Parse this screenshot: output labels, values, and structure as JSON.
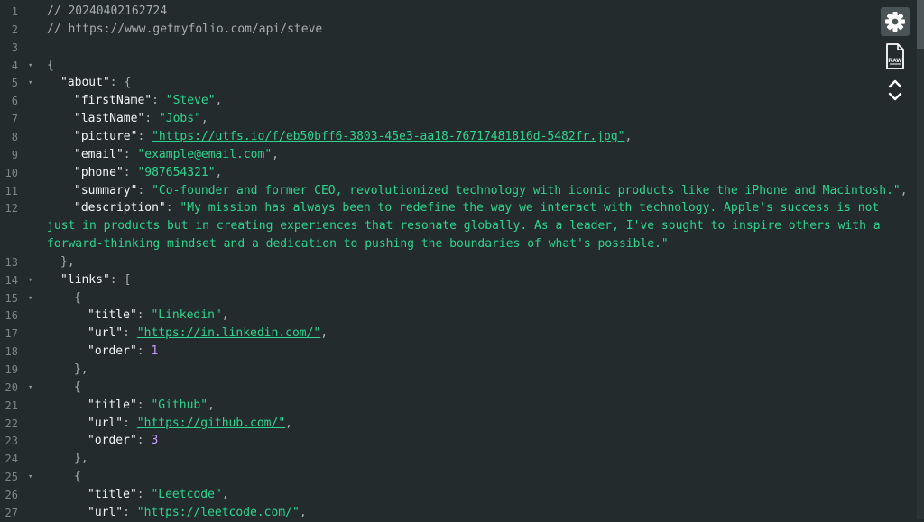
{
  "toolbar": {
    "settings_icon": "gear-icon",
    "raw_icon": "raw-file-icon",
    "raw_label": "RAW",
    "collapse_icon": "expand-collapse-chevrons-icon"
  },
  "lines": [
    {
      "n": "1",
      "fold": false,
      "indent": 0,
      "tokens": [
        {
          "t": "cmt",
          "v": "// 20240402162724"
        }
      ]
    },
    {
      "n": "2",
      "fold": false,
      "indent": 0,
      "tokens": [
        {
          "t": "cmt",
          "v": "// https://www.getmyfolio.com/api/steve"
        }
      ]
    },
    {
      "n": "3",
      "fold": false,
      "indent": 0,
      "tokens": []
    },
    {
      "n": "4",
      "fold": true,
      "indent": 0,
      "tokens": [
        {
          "t": "punc",
          "v": "{"
        }
      ]
    },
    {
      "n": "5",
      "fold": true,
      "indent": 1,
      "tokens": [
        {
          "t": "key",
          "v": "\"about\""
        },
        {
          "t": "punc",
          "v": ": {"
        }
      ]
    },
    {
      "n": "6",
      "fold": false,
      "indent": 2,
      "tokens": [
        {
          "t": "key",
          "v": "\"firstName\""
        },
        {
          "t": "punc",
          "v": ": "
        },
        {
          "t": "str",
          "v": "\"Steve\""
        },
        {
          "t": "punc",
          "v": ","
        }
      ]
    },
    {
      "n": "7",
      "fold": false,
      "indent": 2,
      "tokens": [
        {
          "t": "key",
          "v": "\"lastName\""
        },
        {
          "t": "punc",
          "v": ": "
        },
        {
          "t": "str",
          "v": "\"Jobs\""
        },
        {
          "t": "punc",
          "v": ","
        }
      ]
    },
    {
      "n": "8",
      "fold": false,
      "indent": 2,
      "tokens": [
        {
          "t": "key",
          "v": "\"picture\""
        },
        {
          "t": "punc",
          "v": ": "
        },
        {
          "t": "url",
          "v": "\"https://utfs.io/f/eb50bff6-3803-45e3-aa18-76717481816d-5482fr.jpg\""
        },
        {
          "t": "punc",
          "v": ","
        }
      ]
    },
    {
      "n": "9",
      "fold": false,
      "indent": 2,
      "tokens": [
        {
          "t": "key",
          "v": "\"email\""
        },
        {
          "t": "punc",
          "v": ": "
        },
        {
          "t": "str",
          "v": "\"example@email.com\""
        },
        {
          "t": "punc",
          "v": ","
        }
      ]
    },
    {
      "n": "10",
      "fold": false,
      "indent": 2,
      "tokens": [
        {
          "t": "key",
          "v": "\"phone\""
        },
        {
          "t": "punc",
          "v": ": "
        },
        {
          "t": "str",
          "v": "\"987654321\""
        },
        {
          "t": "punc",
          "v": ","
        }
      ]
    },
    {
      "n": "11",
      "fold": false,
      "indent": 2,
      "tokens": [
        {
          "t": "key",
          "v": "\"summary\""
        },
        {
          "t": "punc",
          "v": ": "
        },
        {
          "t": "str",
          "v": "\"Co-founder and former CEO, revolutionized technology with iconic products like the iPhone and Macintosh.\""
        },
        {
          "t": "punc",
          "v": ","
        }
      ]
    },
    {
      "n": "12",
      "fold": false,
      "indent": 2,
      "tokens": [
        {
          "t": "key",
          "v": "\"description\""
        },
        {
          "t": "punc",
          "v": ": "
        },
        {
          "t": "str",
          "v": "\"My mission has always been to redefine the way we interact with technology. Apple's success is not"
        }
      ]
    },
    {
      "n": "",
      "fold": false,
      "indent": 0,
      "tokens": [
        {
          "t": "str",
          "v": "just in products but in creating experiences that resonate globally. As a leader, I've sought to inspire others with a"
        }
      ]
    },
    {
      "n": "",
      "fold": false,
      "indent": 0,
      "tokens": [
        {
          "t": "str",
          "v": "forward-thinking mindset and a dedication to pushing the boundaries of what's possible.\""
        }
      ]
    },
    {
      "n": "13",
      "fold": false,
      "indent": 1,
      "tokens": [
        {
          "t": "punc",
          "v": "},"
        }
      ]
    },
    {
      "n": "14",
      "fold": true,
      "indent": 1,
      "tokens": [
        {
          "t": "key",
          "v": "\"links\""
        },
        {
          "t": "punc",
          "v": ": ["
        }
      ]
    },
    {
      "n": "15",
      "fold": true,
      "indent": 2,
      "tokens": [
        {
          "t": "punc",
          "v": "{"
        }
      ]
    },
    {
      "n": "16",
      "fold": false,
      "indent": 3,
      "tokens": [
        {
          "t": "key",
          "v": "\"title\""
        },
        {
          "t": "punc",
          "v": ": "
        },
        {
          "t": "str",
          "v": "\"Linkedin\""
        },
        {
          "t": "punc",
          "v": ","
        }
      ]
    },
    {
      "n": "17",
      "fold": false,
      "indent": 3,
      "tokens": [
        {
          "t": "key",
          "v": "\"url\""
        },
        {
          "t": "punc",
          "v": ": "
        },
        {
          "t": "url",
          "v": "\"https://in.linkedin.com/\""
        },
        {
          "t": "punc",
          "v": ","
        }
      ]
    },
    {
      "n": "18",
      "fold": false,
      "indent": 3,
      "tokens": [
        {
          "t": "key",
          "v": "\"order\""
        },
        {
          "t": "punc",
          "v": ": "
        },
        {
          "t": "num",
          "v": "1"
        }
      ]
    },
    {
      "n": "19",
      "fold": false,
      "indent": 2,
      "tokens": [
        {
          "t": "punc",
          "v": "},"
        }
      ]
    },
    {
      "n": "20",
      "fold": true,
      "indent": 2,
      "tokens": [
        {
          "t": "punc",
          "v": "{"
        }
      ]
    },
    {
      "n": "21",
      "fold": false,
      "indent": 3,
      "tokens": [
        {
          "t": "key",
          "v": "\"title\""
        },
        {
          "t": "punc",
          "v": ": "
        },
        {
          "t": "str",
          "v": "\"Github\""
        },
        {
          "t": "punc",
          "v": ","
        }
      ]
    },
    {
      "n": "22",
      "fold": false,
      "indent": 3,
      "tokens": [
        {
          "t": "key",
          "v": "\"url\""
        },
        {
          "t": "punc",
          "v": ": "
        },
        {
          "t": "url",
          "v": "\"https://github.com/\""
        },
        {
          "t": "punc",
          "v": ","
        }
      ]
    },
    {
      "n": "23",
      "fold": false,
      "indent": 3,
      "tokens": [
        {
          "t": "key",
          "v": "\"order\""
        },
        {
          "t": "punc",
          "v": ": "
        },
        {
          "t": "num",
          "v": "3"
        }
      ]
    },
    {
      "n": "24",
      "fold": false,
      "indent": 2,
      "tokens": [
        {
          "t": "punc",
          "v": "},"
        }
      ]
    },
    {
      "n": "25",
      "fold": true,
      "indent": 2,
      "tokens": [
        {
          "t": "punc",
          "v": "{"
        }
      ]
    },
    {
      "n": "26",
      "fold": false,
      "indent": 3,
      "tokens": [
        {
          "t": "key",
          "v": "\"title\""
        },
        {
          "t": "punc",
          "v": ": "
        },
        {
          "t": "str",
          "v": "\"Leetcode\""
        },
        {
          "t": "punc",
          "v": ","
        }
      ]
    },
    {
      "n": "27",
      "fold": false,
      "indent": 3,
      "tokens": [
        {
          "t": "key",
          "v": "\"url\""
        },
        {
          "t": "punc",
          "v": ": "
        },
        {
          "t": "url",
          "v": "\"https://leetcode.com/\""
        },
        {
          "t": "punc",
          "v": ","
        }
      ]
    }
  ]
}
